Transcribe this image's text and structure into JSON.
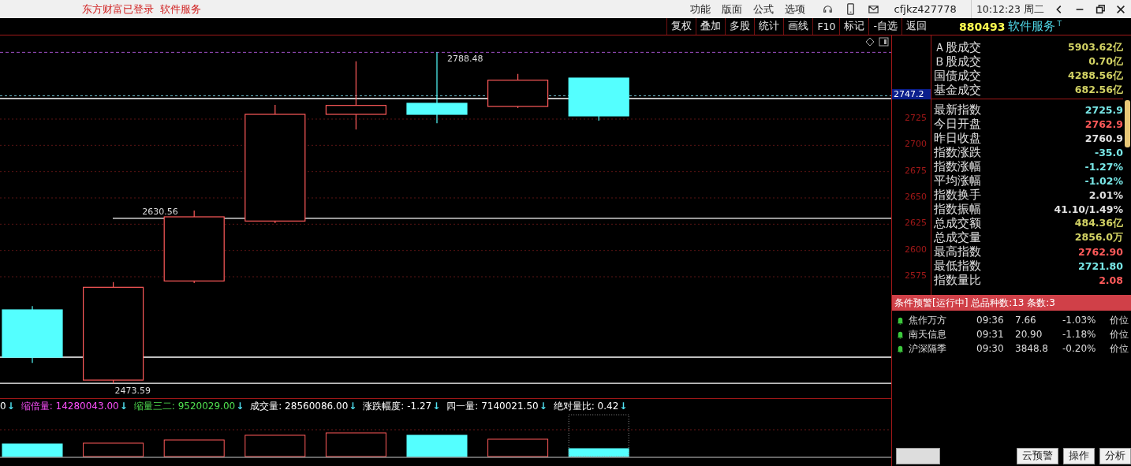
{
  "top_bar": {
    "login_status": "东方财富已登录",
    "service_link": "软件服务",
    "menu": [
      "功能",
      "版面",
      "公式",
      "选项"
    ],
    "account": "cfjkz427778",
    "clock": "10:12:23 周二"
  },
  "toolbar": [
    "复权",
    "叠加",
    "多股",
    "统计",
    "画线",
    "F10",
    "标记",
    "-自选",
    "返回"
  ],
  "chart": {
    "price_tag": "2747.2",
    "axis_labels": [
      "2725",
      "2700",
      "2675",
      "2650",
      "2625",
      "2600",
      "2575"
    ],
    "price_labels": [
      {
        "text": "2788.48",
        "kind": "high"
      },
      {
        "text": "2630.56",
        "kind": "line"
      },
      {
        "text": "2473.59",
        "kind": "low"
      }
    ]
  },
  "volume_legend": [
    {
      "text": "0",
      "arrow": "↓",
      "color": "#ffffff"
    },
    {
      "text": "缩倍量: 14280043.00",
      "arrow": "↓",
      "color": "#ff50ff"
    },
    {
      "text": "缩量三二: 9520029.00",
      "arrow": "↓",
      "color": "#50e050"
    },
    {
      "text": "成交量: 28560086.00",
      "arrow": "↓",
      "color": "#ffffff"
    },
    {
      "text": "涨跌幅度: -1.27",
      "arrow": "↓",
      "color": "#ffffff"
    },
    {
      "text": "四一量: 7140021.50",
      "arrow": "↓",
      "color": "#ffffff"
    },
    {
      "text": "绝对量比: 0.42",
      "arrow": "↓",
      "color": "#ffffff"
    }
  ],
  "quote_panel": {
    "code": "880493",
    "name": "软件服务",
    "mark": "T",
    "summary": [
      {
        "label": "Ａ股成交",
        "value": "5903.62亿",
        "color": "#d2d264"
      },
      {
        "label": "Ｂ股成交",
        "value": "0.70亿",
        "color": "#d2d264"
      },
      {
        "label": "国债成交",
        "value": "4288.56亿",
        "color": "#d2d264"
      },
      {
        "label": "基金成交",
        "value": "682.56亿",
        "color": "#d2d264"
      }
    ],
    "stats": [
      {
        "label": "最新指数",
        "value": "2725.9",
        "color": "#78e6e6"
      },
      {
        "label": "今日开盘",
        "value": "2762.9",
        "color": "#ff5a5a"
      },
      {
        "label": "昨日收盘",
        "value": "2760.9",
        "color": "#e0e0e0"
      },
      {
        "label": "指数涨跌",
        "value": "-35.0",
        "color": "#78e6e6"
      },
      {
        "label": "指数涨幅",
        "value": "-1.27%",
        "color": "#78e6e6"
      },
      {
        "label": "平均涨幅",
        "value": "-1.02%",
        "color": "#78e6e6"
      },
      {
        "label": "指数换手",
        "value": "2.01%",
        "color": "#e0e0e0"
      },
      {
        "label": "指数振幅",
        "value": "41.10/1.49%",
        "color": "#e0e0e0"
      },
      {
        "label": "总成交额",
        "value": "484.36亿",
        "color": "#d2d264"
      },
      {
        "label": "总成交量",
        "value": "2856.0万",
        "color": "#d2d264"
      },
      {
        "label": "最高指数",
        "value": "2762.90",
        "color": "#ff5a5a"
      },
      {
        "label": "最低指数",
        "value": "2721.80",
        "color": "#78e6e6"
      },
      {
        "label": "指数量比",
        "value": "2.08",
        "color": "#ff5a5a"
      }
    ]
  },
  "alerts": {
    "header": "条件预警[运行中] 总品种数:13 条数:3",
    "rows": [
      {
        "name": "焦作万方",
        "time": "09:36",
        "price": "7.66",
        "change": "-1.03%",
        "type": "价位"
      },
      {
        "name": "南天信息",
        "time": "09:31",
        "price": "20.90",
        "change": "-1.18%",
        "type": "价位"
      },
      {
        "name": "沪深隔季",
        "time": "09:30",
        "price": "3848.8",
        "change": "-0.20%",
        "type": "价位"
      }
    ],
    "buttons": [
      "云预警",
      "操作",
      "分析"
    ]
  }
}
